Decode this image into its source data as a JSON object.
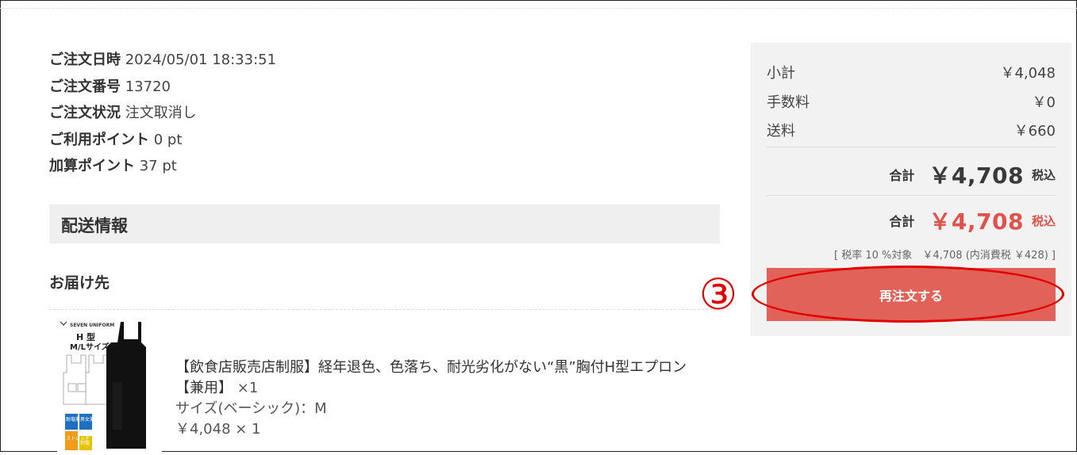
{
  "order_info": [
    {
      "label": "ご注文日時",
      "value": "2024/05/01 18:33:51"
    },
    {
      "label": "ご注文番号",
      "value": "13720"
    },
    {
      "label": "ご注文状況",
      "value": "注文取消し"
    },
    {
      "label": "ご利用ポイント",
      "value": "0 pt"
    },
    {
      "label": "加算ポイント",
      "value": "37 pt"
    }
  ],
  "shipping": {
    "heading": "配送情報",
    "destination_heading": "お届け先"
  },
  "product": {
    "image_logo": "SEVEN UNIFORM",
    "image_type_line1": "H 型",
    "image_type_line2": "M/Lサイズ",
    "image_badge_1": "耐塩素",
    "image_badge_2": "男女兼用",
    "image_badge_3": "ストレッチ",
    "image_badge_4": "制電",
    "title": "【飲食店販売店制服】経年退色、色落ち、耐光劣化がない“黒”胸付H型エプロン",
    "title_suffix": "【兼用】",
    "quantity_text": "×1",
    "size": "サイズ(ベーシック)：M",
    "price_qty": "￥4,048 × 1"
  },
  "summary": {
    "subtotal_label": "小計",
    "subtotal_value": "￥4,048",
    "fee_label": "手数料",
    "fee_value": "￥0",
    "shipping_label": "送料",
    "shipping_value": "￥660",
    "total_label": "合計",
    "total_value": "￥4,708",
    "tax_included": "税込",
    "grand_total_label": "合計",
    "grand_total_value": "￥4,708",
    "grand_tax_included": "税込",
    "tax_note": "[ 税率 10 %対象　￥4,708 (内消費税 ￥428) ]",
    "reorder_label": "再注文する"
  },
  "annotation": {
    "step_number": "③"
  },
  "colors": {
    "accent_red": "#e0524a",
    "button_red": "#e06258",
    "callout_red": "#e00000",
    "summary_bg": "#f2f2f2"
  }
}
